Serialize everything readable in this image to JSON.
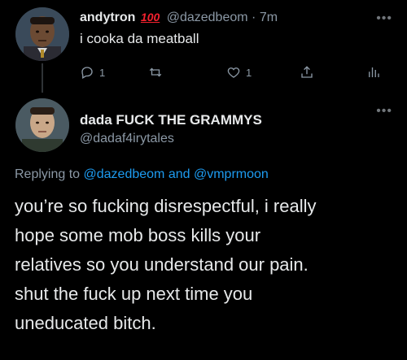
{
  "tweet1": {
    "display_name": "andytron",
    "badge": "100",
    "handle": "@dazedbeom",
    "separator": "·",
    "time": "7m",
    "text": "i cooka da meatball",
    "actions": {
      "reply_count": "1",
      "retweet_count": "",
      "like_count": "1"
    }
  },
  "tweet2": {
    "display_name": "dada FUCK THE GRAMMYS",
    "handle": "@dadaf4irytales",
    "replying_prefix": "Replying to",
    "replying_user1": "@dazedbeom",
    "replying_and": "and",
    "replying_user2": "@vmprmoon",
    "text_lines": [
      "you’re so fucking disrespectful, i really",
      "hope some mob boss kills your",
      "relatives so you understand our pain.",
      "shut the fuck up next time you",
      "uneducated bitch."
    ]
  },
  "icons": {
    "more": "more-dots-icon",
    "reply": "reply-icon",
    "retweet": "retweet-icon",
    "like": "heart-icon",
    "share": "share-icon",
    "analytics": "analytics-icon"
  },
  "colors": {
    "background": "#000000",
    "text": "#e7e9ea",
    "muted": "#8b98a5",
    "link": "#1d9bf0",
    "badge": "#f4212e"
  }
}
